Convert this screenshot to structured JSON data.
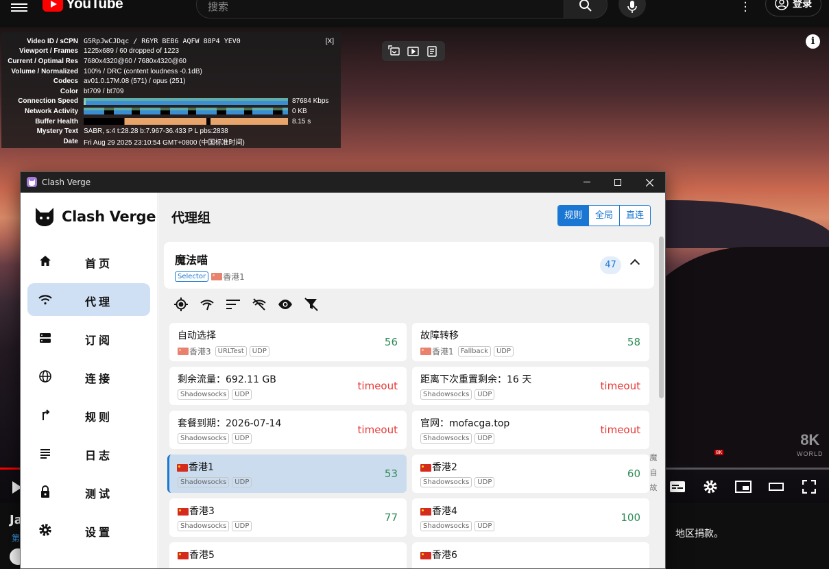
{
  "youtube": {
    "logo_text": "YouTube",
    "search_placeholder": "搜索",
    "signin_label": "登录",
    "watermark": "8K",
    "watermark_sub": "WORLD",
    "hd_badge": "8K",
    "below_title": "Ja",
    "below_sub": "第",
    "below_right": "地区捐款。"
  },
  "stats": {
    "close": "[X]",
    "rows": [
      {
        "k": "Video ID / sCPN",
        "v": "G5RpJwCJDqc  /  R6YR  BEB6  AQFW  88P4  YEV0"
      },
      {
        "k": "Viewport / Frames",
        "v": "1225x689 / 60 dropped of 1223"
      },
      {
        "k": "Current / Optimal Res",
        "v": "7680x4320@60 / 7680x4320@60"
      },
      {
        "k": "Volume / Normalized",
        "v": "100% / DRC (content loudness -0.1dB)"
      },
      {
        "k": "Codecs",
        "v": "av01.0.17M.08 (571) / opus (251)"
      },
      {
        "k": "Color",
        "v": "bt709 / bt709"
      },
      {
        "k": "Connection Speed",
        "v": "87684 Kbps"
      },
      {
        "k": "Network Activity",
        "v": "0 KB"
      },
      {
        "k": "Buffer Health",
        "v": "8.15 s"
      },
      {
        "k": "Mystery Text",
        "v": "SABR, s:4 t:28.28 b:7.967-36.433 P L pbs:2838"
      },
      {
        "k": "Date",
        "v": "Fri Aug 29 2025 23:10:54 GMT+0800 (中国标准时间)"
      }
    ]
  },
  "clash": {
    "window_title": "Clash Verge",
    "brand": "Clash Verge",
    "nav": [
      {
        "label": "首页",
        "icon": "home-icon"
      },
      {
        "label": "代理",
        "icon": "wifi-icon"
      },
      {
        "label": "订阅",
        "icon": "storage-icon"
      },
      {
        "label": "连接",
        "icon": "globe-icon"
      },
      {
        "label": "规则",
        "icon": "fork-icon"
      },
      {
        "label": "日志",
        "icon": "list-icon"
      },
      {
        "label": "测试",
        "icon": "lock-icon"
      },
      {
        "label": "设置",
        "icon": "gear-icon"
      }
    ],
    "page_title": "代理组",
    "modes": [
      "规则",
      "全局",
      "直连"
    ],
    "group": {
      "name": "魔法喵",
      "type": "Selector",
      "current": "香港1",
      "count": "47"
    },
    "side_chars": "魔自故",
    "cards": [
      {
        "name": "自动选择",
        "flag": "香港3",
        "tags": [
          "URLTest",
          "UDP"
        ],
        "delay": "56",
        "status": "ok"
      },
      {
        "name": "故障转移",
        "flag": "香港1",
        "tags": [
          "Fallback",
          "UDP"
        ],
        "delay": "58",
        "status": "ok"
      },
      {
        "name": "剩余流量：692.11 GB",
        "flag": "",
        "tags": [
          "Shadowsocks",
          "UDP"
        ],
        "delay": "timeout",
        "status": "bad"
      },
      {
        "name": "距离下次重置剩余：16 天",
        "flag": "",
        "tags": [
          "Shadowsocks",
          "UDP"
        ],
        "delay": "timeout",
        "status": "bad"
      },
      {
        "name": "套餐到期：2026-07-14",
        "flag": "",
        "tags": [
          "Shadowsocks",
          "UDP"
        ],
        "delay": "timeout",
        "status": "bad"
      },
      {
        "name": "官网：mofacga.top",
        "flag": "",
        "tags": [
          "Shadowsocks",
          "UDP"
        ],
        "delay": "timeout",
        "status": "bad"
      },
      {
        "name": "香港1",
        "flag": "cn",
        "tags": [
          "Shadowsocks",
          "UDP"
        ],
        "delay": "53",
        "status": "ok"
      },
      {
        "name": "香港2",
        "flag": "cn",
        "tags": [
          "Shadowsocks",
          "UDP"
        ],
        "delay": "60",
        "status": "ok"
      },
      {
        "name": "香港3",
        "flag": "cn",
        "tags": [
          "Shadowsocks",
          "UDP"
        ],
        "delay": "77",
        "status": "ok"
      },
      {
        "name": "香港4",
        "flag": "cn",
        "tags": [
          "Shadowsocks",
          "UDP"
        ],
        "delay": "100",
        "status": "ok"
      },
      {
        "name": "香港5",
        "flag": "cn",
        "tags": [],
        "delay": "",
        "status": "ok"
      },
      {
        "name": "香港6",
        "flag": "cn",
        "tags": [],
        "delay": "",
        "status": "ok"
      }
    ],
    "colors": {
      "accent": "#1976d2",
      "ok": "#2e8b57",
      "timeout": "#e53935",
      "selected_bg": "#cbdcee"
    }
  }
}
